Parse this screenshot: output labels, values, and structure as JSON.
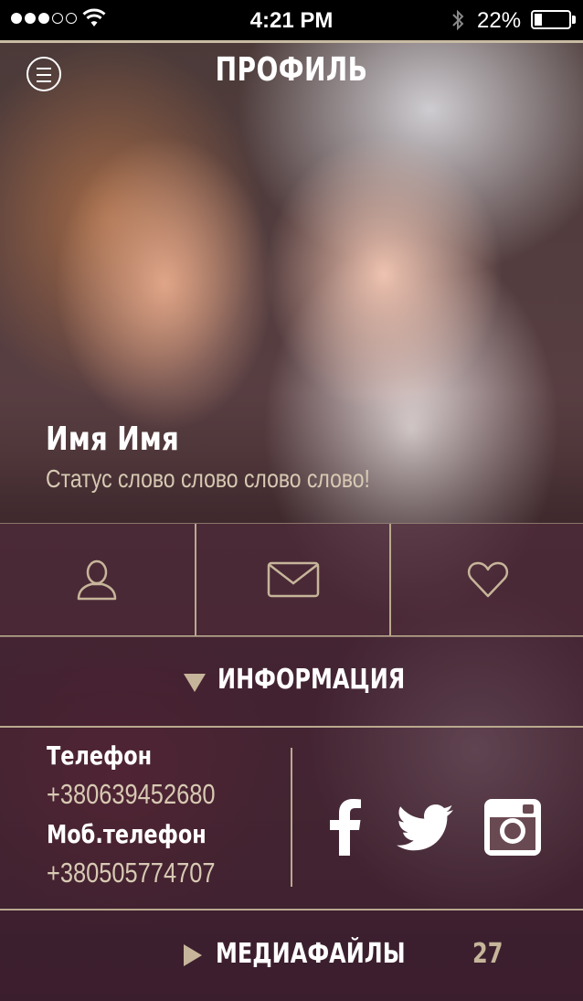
{
  "status_bar": {
    "signal_dots_filled": 3,
    "signal_dots_total": 5,
    "time": "4:21 PM",
    "battery_percent_text": "22%",
    "battery_level": 0.22,
    "icons": [
      "signal-icon",
      "wifi-icon",
      "bluetooth-icon",
      "battery-icon"
    ]
  },
  "header": {
    "title": "ПРОФИЛЬ",
    "menu_icon": "menu-icon"
  },
  "profile": {
    "name": "Имя Имя",
    "status": "Статус слово слово слово слово!"
  },
  "actions": [
    {
      "icon": "user-icon"
    },
    {
      "icon": "mail-icon"
    },
    {
      "icon": "heart-icon"
    }
  ],
  "info_section": {
    "label": "ИНФОРМАЦИЯ",
    "expanded": true,
    "phone_label": "Телефон",
    "phone_value": "+380639452680",
    "mobile_label": "Моб.телефон",
    "mobile_value": "+380505774707",
    "social": [
      "facebook-icon",
      "twitter-icon",
      "instagram-icon"
    ]
  },
  "media_section": {
    "label": "МЕДИАФАЙЛЫ",
    "count": "27",
    "expanded": false
  },
  "colors": {
    "accent": "#c6b59a",
    "text_muted": "#d7c9b3",
    "divider": "#b9a98f",
    "white": "#ffffff"
  }
}
